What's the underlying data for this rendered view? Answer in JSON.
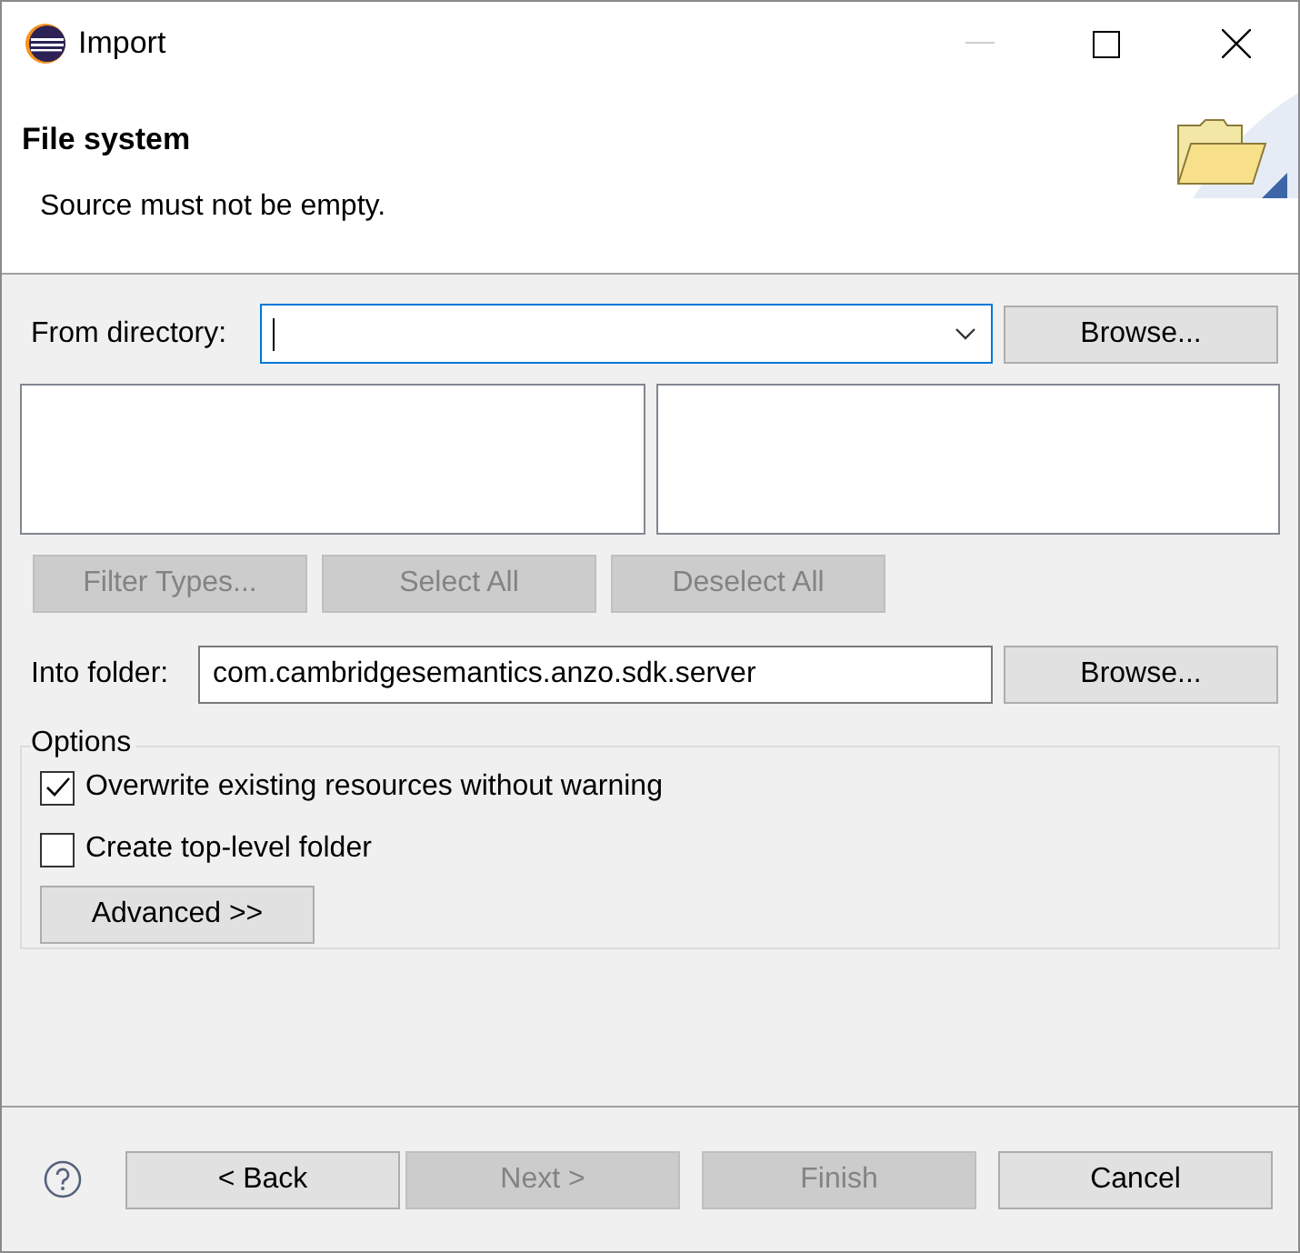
{
  "window": {
    "title": "Import"
  },
  "header": {
    "title": "File system",
    "message": "Source must not be empty."
  },
  "source": {
    "label": "From directory:",
    "focused": true,
    "browse": "Browse..."
  },
  "list_buttons": [
    {
      "label": "Filter Types...",
      "disabled": true
    },
    {
      "label": "Select All",
      "disabled": true
    },
    {
      "label": "Deselect All",
      "disabled": true
    }
  ],
  "destination": {
    "label": "Into folder:",
    "value": "com.cambridgesemantics.anzo.sdk.server",
    "browse": "Browse..."
  },
  "options": {
    "title": "Options",
    "checkboxes": [
      {
        "label": "Overwrite existing resources without warning",
        "checked": true
      },
      {
        "label": "Create top-level folder",
        "checked": false
      }
    ],
    "advanced": "Advanced >>"
  },
  "footer": {
    "buttons": [
      {
        "label": "< Back",
        "disabled": false
      },
      {
        "label": "Next >",
        "disabled": true
      },
      {
        "label": "Finish",
        "disabled": true
      },
      {
        "label": "Cancel",
        "disabled": false
      }
    ]
  }
}
